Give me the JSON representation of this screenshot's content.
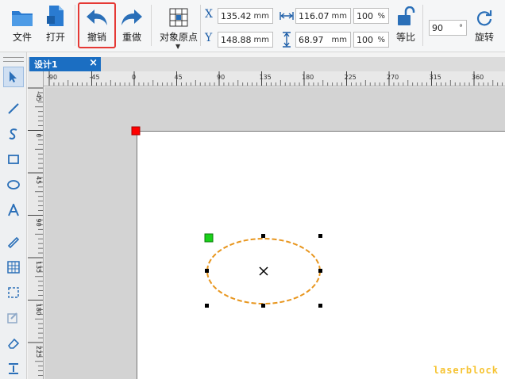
{
  "toolbar": {
    "file": "文件",
    "open": "打开",
    "undo": "撤销",
    "redo": "重做",
    "origin": "对象原点",
    "proportional": "等比",
    "rotate": "旋转"
  },
  "fields": {
    "x_label": "X",
    "x_value": "135.42",
    "y_label": "Y",
    "y_value": "148.88",
    "width_value": "116.07",
    "height_value": "68.97",
    "unit": "mm",
    "width_pct": "100",
    "height_pct": "100",
    "pct_unit": "%",
    "angle": "90",
    "angle_unit": "°"
  },
  "tab": {
    "title": "设计1",
    "close": "×"
  },
  "ruler": {
    "h_ticks": [
      "-90",
      "-45",
      "0",
      "45",
      "90",
      "135",
      "180",
      "225",
      "270",
      "315",
      "360"
    ],
    "v_ticks": [
      "-45",
      "0",
      "45",
      "90",
      "135",
      "180",
      "225"
    ]
  },
  "watermark": "laserblock",
  "colors": {
    "accent": "#1b6ec2",
    "highlight": "#e53935",
    "ellipse": "#e8961e",
    "anchor": "#19d119",
    "origin": "#ff0000"
  }
}
